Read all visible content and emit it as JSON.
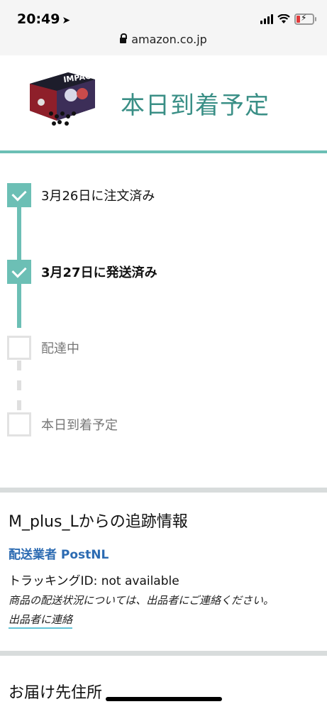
{
  "status_bar": {
    "time": "20:49",
    "location_icon": "location-arrow-icon",
    "battery_color": "#e03a3a"
  },
  "browser": {
    "url": "amazon.co.jp",
    "lock_icon": "lock-icon"
  },
  "header": {
    "image_icon": "product-box-image",
    "title": "本日到着予定",
    "title_color": "#3a8f86"
  },
  "timeline": {
    "accent_color": "#6cbfb5",
    "steps": [
      {
        "label": "3月26日に注文済み",
        "done": true
      },
      {
        "label": "3月27日に発送済み",
        "done": true
      },
      {
        "label": "配達中",
        "done": false
      },
      {
        "label": "本日到着予定",
        "done": false
      }
    ]
  },
  "tracking": {
    "title": "M_plus_Lからの追跡情報",
    "carrier": "配送業者 PostNL",
    "carrier_color": "#2c6bb2",
    "tracking_id": "トラッキングID: not available",
    "note": "商品の配送状況については、出品者にご連絡ください。",
    "contact_link": "出品者に連絡"
  },
  "address": {
    "title": "お届け先住所"
  }
}
